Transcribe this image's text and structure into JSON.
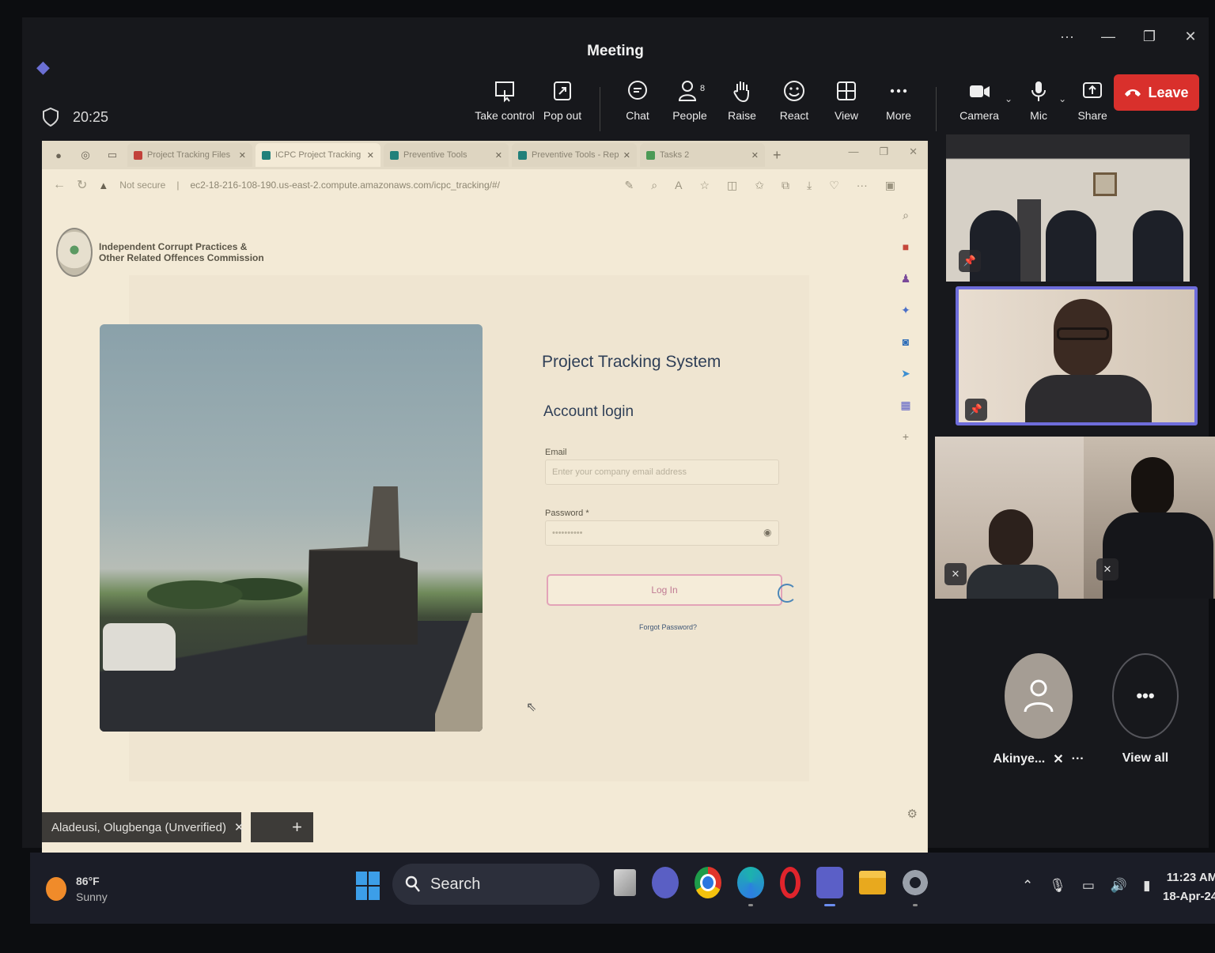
{
  "meeting": {
    "title": "Meeting",
    "elapsed_time": "20:25",
    "toolbar": {
      "take_control": "Take control",
      "pop_out": "Pop out",
      "chat": "Chat",
      "people": "People",
      "people_count": "8",
      "raise": "Raise",
      "react": "React",
      "view": "View",
      "more": "More",
      "camera": "Camera",
      "mic": "Mic",
      "share": "Share",
      "leave": "Leave"
    },
    "presenter_name": "Aladeusi, Olugbenga (Unverified)",
    "participants": {
      "avatar_name": "Akinye...",
      "view_all": "View all"
    }
  },
  "browser": {
    "tabs": [
      {
        "label": "Project Tracking Files",
        "active": false
      },
      {
        "label": "ICPC Project Tracking",
        "active": true
      },
      {
        "label": "Preventive Tools",
        "active": false
      },
      {
        "label": "Preventive Tools - Rep",
        "active": false
      },
      {
        "label": "Tasks 2",
        "active": false
      }
    ],
    "security_label": "Not secure",
    "url": "ec2-18-216-108-190.us-east-2.compute.amazonaws.com/icpc_tracking/#/"
  },
  "page": {
    "org_name_line1": "Independent Corrupt Practices &",
    "org_name_line2": "Other Related Offences Commission",
    "system_title": "Project Tracking System",
    "account_login": "Account login",
    "email_label": "Email",
    "email_placeholder": "Enter your company email address",
    "password_label": "Password *",
    "password_value": "••••••••••",
    "login_button": "Log In",
    "forgot_password": "Forgot Password?"
  },
  "taskbar": {
    "temperature": "86°F",
    "weather": "Sunny",
    "search": "Search",
    "time": "11:23 AM",
    "date": "18-Apr-24"
  },
  "colors": {
    "leave_red": "#d9302c",
    "teams_purple": "#6e6ddb",
    "heading_navy": "#2f3f57",
    "login_border_pink": "#e3a3b8"
  }
}
